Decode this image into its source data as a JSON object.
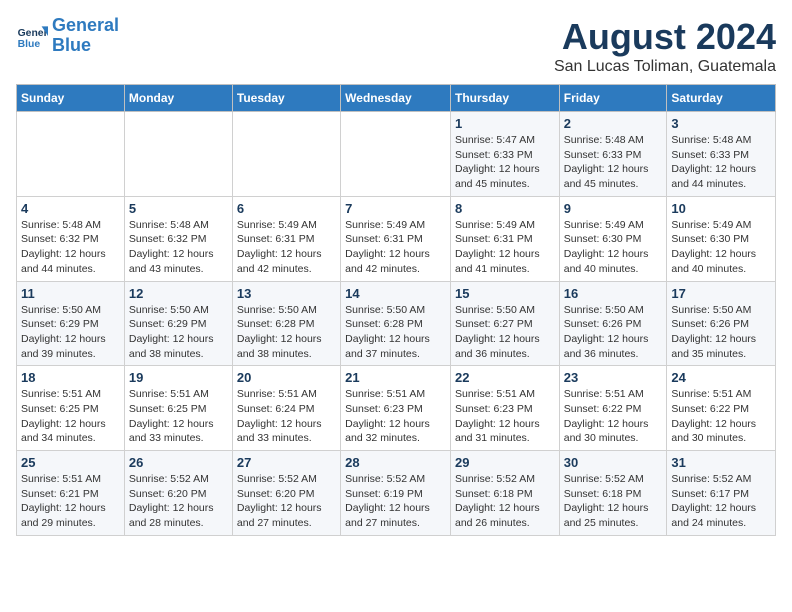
{
  "logo": {
    "line1": "General",
    "line2": "Blue"
  },
  "title": "August 2024",
  "subtitle": "San Lucas Toliman, Guatemala",
  "days_of_week": [
    "Sunday",
    "Monday",
    "Tuesday",
    "Wednesday",
    "Thursday",
    "Friday",
    "Saturday"
  ],
  "weeks": [
    [
      {
        "day": "",
        "info": ""
      },
      {
        "day": "",
        "info": ""
      },
      {
        "day": "",
        "info": ""
      },
      {
        "day": "",
        "info": ""
      },
      {
        "day": "1",
        "info": "Sunrise: 5:47 AM\nSunset: 6:33 PM\nDaylight: 12 hours\nand 45 minutes."
      },
      {
        "day": "2",
        "info": "Sunrise: 5:48 AM\nSunset: 6:33 PM\nDaylight: 12 hours\nand 45 minutes."
      },
      {
        "day": "3",
        "info": "Sunrise: 5:48 AM\nSunset: 6:33 PM\nDaylight: 12 hours\nand 44 minutes."
      }
    ],
    [
      {
        "day": "4",
        "info": "Sunrise: 5:48 AM\nSunset: 6:32 PM\nDaylight: 12 hours\nand 44 minutes."
      },
      {
        "day": "5",
        "info": "Sunrise: 5:48 AM\nSunset: 6:32 PM\nDaylight: 12 hours\nand 43 minutes."
      },
      {
        "day": "6",
        "info": "Sunrise: 5:49 AM\nSunset: 6:31 PM\nDaylight: 12 hours\nand 42 minutes."
      },
      {
        "day": "7",
        "info": "Sunrise: 5:49 AM\nSunset: 6:31 PM\nDaylight: 12 hours\nand 42 minutes."
      },
      {
        "day": "8",
        "info": "Sunrise: 5:49 AM\nSunset: 6:31 PM\nDaylight: 12 hours\nand 41 minutes."
      },
      {
        "day": "9",
        "info": "Sunrise: 5:49 AM\nSunset: 6:30 PM\nDaylight: 12 hours\nand 40 minutes."
      },
      {
        "day": "10",
        "info": "Sunrise: 5:49 AM\nSunset: 6:30 PM\nDaylight: 12 hours\nand 40 minutes."
      }
    ],
    [
      {
        "day": "11",
        "info": "Sunrise: 5:50 AM\nSunset: 6:29 PM\nDaylight: 12 hours\nand 39 minutes."
      },
      {
        "day": "12",
        "info": "Sunrise: 5:50 AM\nSunset: 6:29 PM\nDaylight: 12 hours\nand 38 minutes."
      },
      {
        "day": "13",
        "info": "Sunrise: 5:50 AM\nSunset: 6:28 PM\nDaylight: 12 hours\nand 38 minutes."
      },
      {
        "day": "14",
        "info": "Sunrise: 5:50 AM\nSunset: 6:28 PM\nDaylight: 12 hours\nand 37 minutes."
      },
      {
        "day": "15",
        "info": "Sunrise: 5:50 AM\nSunset: 6:27 PM\nDaylight: 12 hours\nand 36 minutes."
      },
      {
        "day": "16",
        "info": "Sunrise: 5:50 AM\nSunset: 6:26 PM\nDaylight: 12 hours\nand 36 minutes."
      },
      {
        "day": "17",
        "info": "Sunrise: 5:50 AM\nSunset: 6:26 PM\nDaylight: 12 hours\nand 35 minutes."
      }
    ],
    [
      {
        "day": "18",
        "info": "Sunrise: 5:51 AM\nSunset: 6:25 PM\nDaylight: 12 hours\nand 34 minutes."
      },
      {
        "day": "19",
        "info": "Sunrise: 5:51 AM\nSunset: 6:25 PM\nDaylight: 12 hours\nand 33 minutes."
      },
      {
        "day": "20",
        "info": "Sunrise: 5:51 AM\nSunset: 6:24 PM\nDaylight: 12 hours\nand 33 minutes."
      },
      {
        "day": "21",
        "info": "Sunrise: 5:51 AM\nSunset: 6:23 PM\nDaylight: 12 hours\nand 32 minutes."
      },
      {
        "day": "22",
        "info": "Sunrise: 5:51 AM\nSunset: 6:23 PM\nDaylight: 12 hours\nand 31 minutes."
      },
      {
        "day": "23",
        "info": "Sunrise: 5:51 AM\nSunset: 6:22 PM\nDaylight: 12 hours\nand 30 minutes."
      },
      {
        "day": "24",
        "info": "Sunrise: 5:51 AM\nSunset: 6:22 PM\nDaylight: 12 hours\nand 30 minutes."
      }
    ],
    [
      {
        "day": "25",
        "info": "Sunrise: 5:51 AM\nSunset: 6:21 PM\nDaylight: 12 hours\nand 29 minutes."
      },
      {
        "day": "26",
        "info": "Sunrise: 5:52 AM\nSunset: 6:20 PM\nDaylight: 12 hours\nand 28 minutes."
      },
      {
        "day": "27",
        "info": "Sunrise: 5:52 AM\nSunset: 6:20 PM\nDaylight: 12 hours\nand 27 minutes."
      },
      {
        "day": "28",
        "info": "Sunrise: 5:52 AM\nSunset: 6:19 PM\nDaylight: 12 hours\nand 27 minutes."
      },
      {
        "day": "29",
        "info": "Sunrise: 5:52 AM\nSunset: 6:18 PM\nDaylight: 12 hours\nand 26 minutes."
      },
      {
        "day": "30",
        "info": "Sunrise: 5:52 AM\nSunset: 6:18 PM\nDaylight: 12 hours\nand 25 minutes."
      },
      {
        "day": "31",
        "info": "Sunrise: 5:52 AM\nSunset: 6:17 PM\nDaylight: 12 hours\nand 24 minutes."
      }
    ]
  ]
}
